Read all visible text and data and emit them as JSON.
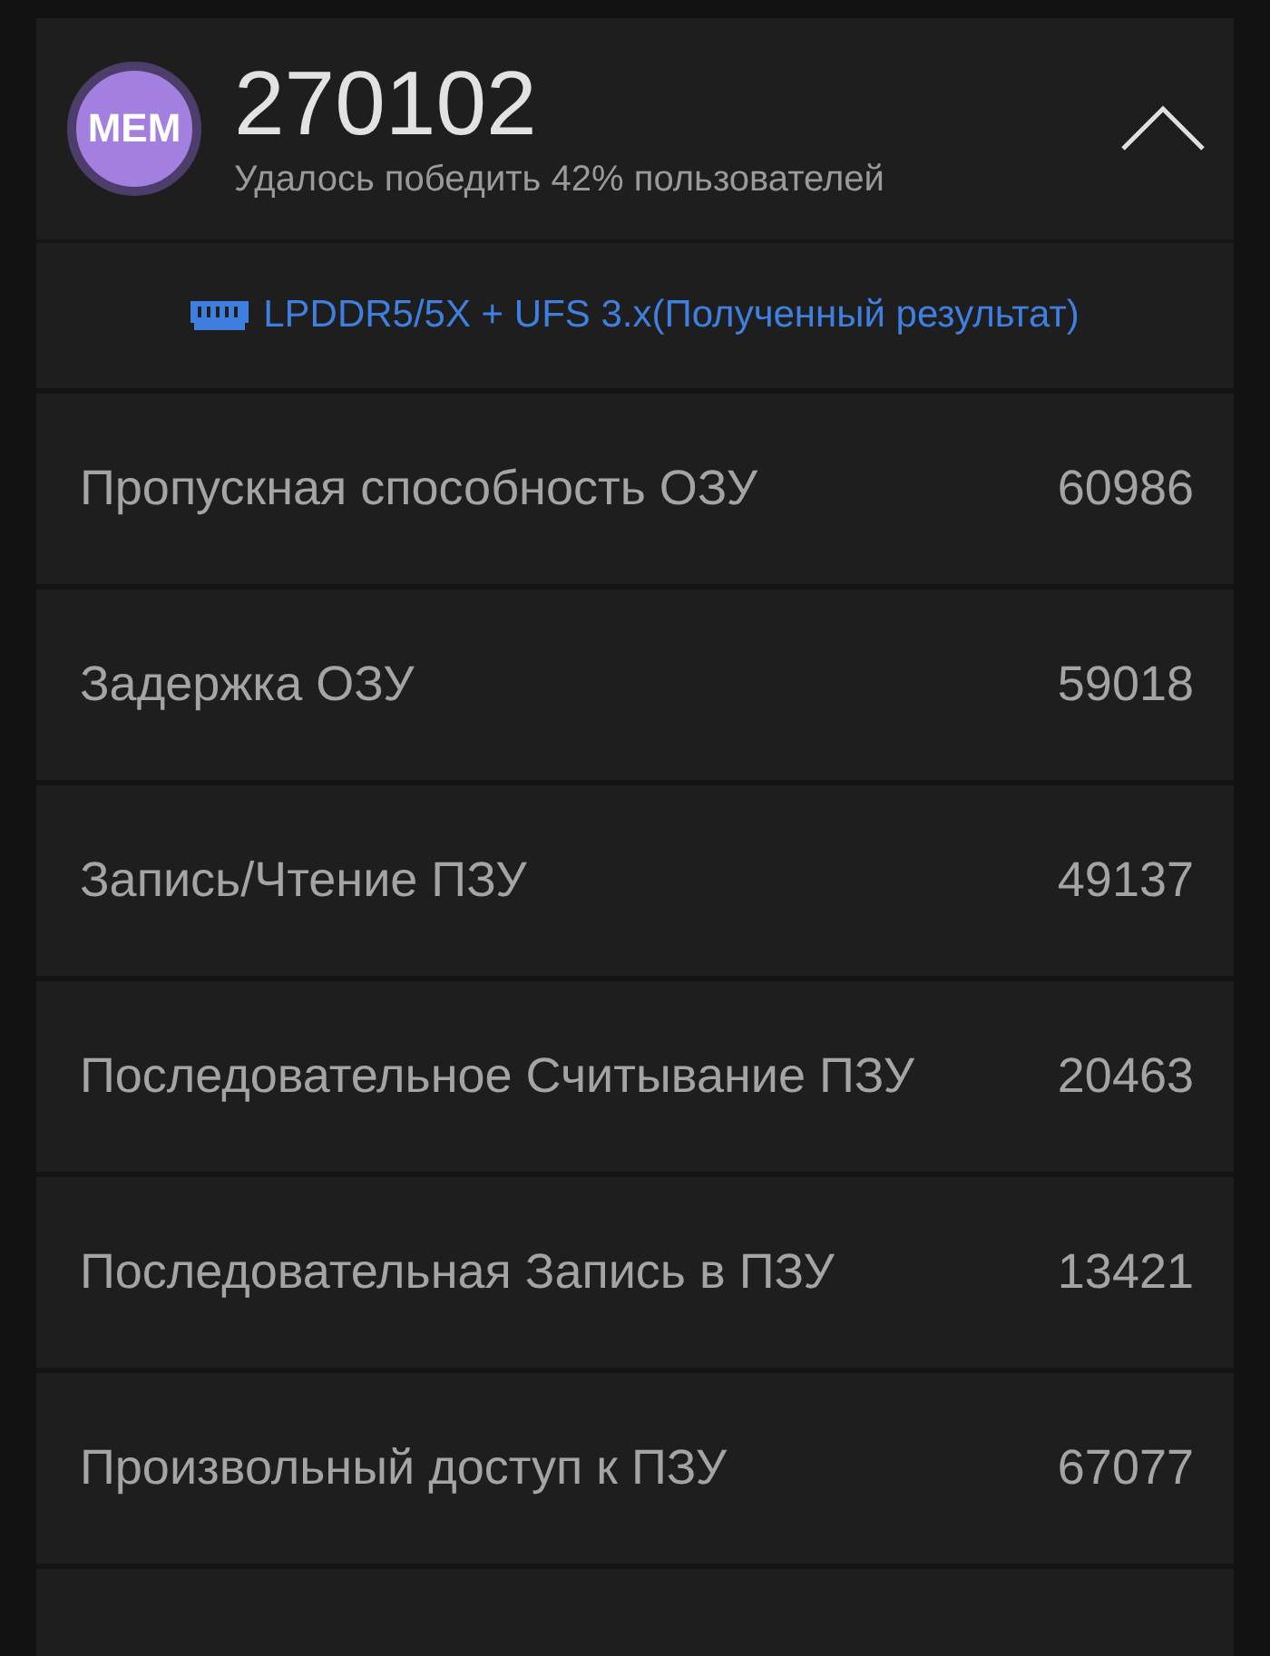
{
  "header": {
    "badge": "MEM",
    "score": "270102",
    "subtitle": "Удалось победить 42% пользователей",
    "expanded": true
  },
  "memory_type": "LPDDR5/5X + UFS 3.x(Полученный результат)",
  "rows": [
    {
      "label": "Пропускная способность ОЗУ",
      "value": "60986"
    },
    {
      "label": "Задержка ОЗУ",
      "value": "59018"
    },
    {
      "label": "Запись/Чтение ПЗУ",
      "value": "49137"
    },
    {
      "label": "Последовательное Считывание ПЗУ",
      "value": "20463"
    },
    {
      "label": "Последовательная Запись в ПЗУ",
      "value": "13421"
    },
    {
      "label": "Произвольный доступ к ПЗУ",
      "value": "67077"
    }
  ]
}
